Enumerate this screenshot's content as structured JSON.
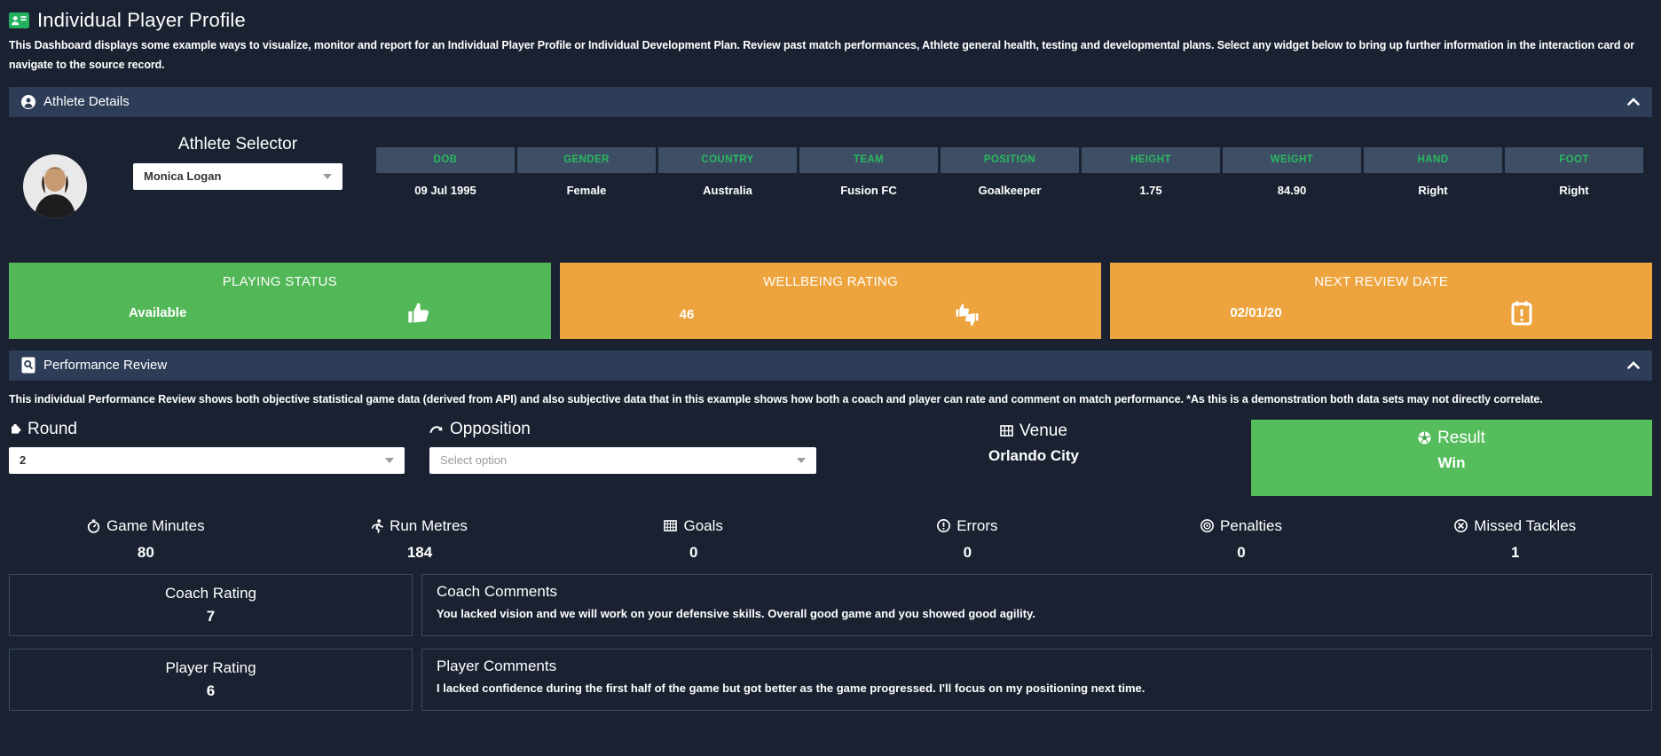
{
  "page": {
    "title": "Individual Player Profile",
    "title_icon": "id-card-icon",
    "description": "This Dashboard displays some example ways to visualize, monitor and report for an Individual Player Profile or Individual Development Plan. Review past match performances, Athlete general health, testing and developmental plans. Select any widget below to bring up further information in the interaction card or navigate to the source record."
  },
  "colors": {
    "background": "#1a2232",
    "section_bar": "#2e3d57",
    "table_header_bg": "#3e4e64",
    "accent_green_text": "#29b960",
    "card_green": "#52b757",
    "card_orange": "#eda43e",
    "result_green": "#55bd5b"
  },
  "athlete_details": {
    "section_title": "Athlete Details",
    "section_icon": "person-icon",
    "collapse_icon": "chevron-up-icon",
    "avatar_icon": "athlete-photo",
    "selector_label": "Athlete Selector",
    "selector_value": "Monica Logan",
    "columns": [
      {
        "header": "DOB",
        "value": "09 Jul 1995"
      },
      {
        "header": "GENDER",
        "value": "Female"
      },
      {
        "header": "COUNTRY",
        "value": "Australia"
      },
      {
        "header": "TEAM",
        "value": "Fusion FC"
      },
      {
        "header": "POSITION",
        "value": "Goalkeeper"
      },
      {
        "header": "HEIGHT",
        "value": "1.75"
      },
      {
        "header": "WEIGHT",
        "value": "84.90"
      },
      {
        "header": "HAND",
        "value": "Right"
      },
      {
        "header": "FOOT",
        "value": "Right"
      }
    ]
  },
  "status_cards": [
    {
      "title": "PLAYING STATUS",
      "value": "Available",
      "icon": "thumbs-up-icon",
      "color": "#52b757"
    },
    {
      "title": "WELLBEING RATING",
      "value": "46",
      "icon": "thumbs-up-down-icon",
      "color": "#eda43e"
    },
    {
      "title": "NEXT REVIEW DATE",
      "value": "02/01/20",
      "icon": "calendar-alert-icon",
      "color": "#eda43e"
    }
  ],
  "performance_review": {
    "section_title": "Performance Review",
    "section_icon": "file-search-icon",
    "collapse_icon": "chevron-up-icon",
    "description": "This individual Performance Review shows both objective statistical game data (derived from API) and also subjective data that in this example shows how both a coach and player can rate and comment on match performance. *As this is a demonstration both data sets may not directly correlate.",
    "round": {
      "label": "Round",
      "value": "2",
      "icon": "puzzle-icon"
    },
    "opposition": {
      "label": "Opposition",
      "placeholder": "Select option",
      "icon": "curved-arrow-icon"
    },
    "venue": {
      "label": "Venue",
      "value": "Orlando City",
      "icon": "stadium-icon"
    },
    "result": {
      "label": "Result",
      "value": "Win",
      "icon": "soccer-ball-icon"
    },
    "stats": [
      {
        "label": "Game Minutes",
        "value": "80",
        "icon": "stopwatch-icon"
      },
      {
        "label": "Run Metres",
        "value": "184",
        "icon": "runner-icon"
      },
      {
        "label": "Goals",
        "value": "0",
        "icon": "goal-net-icon"
      },
      {
        "label": "Errors",
        "value": "0",
        "icon": "error-circle-icon"
      },
      {
        "label": "Penalties",
        "value": "0",
        "icon": "target-icon"
      },
      {
        "label": "Missed Tackles",
        "value": "1",
        "icon": "missed-tackle-icon"
      }
    ],
    "reviews": [
      {
        "rating_label": "Coach Rating",
        "rating_value": "7",
        "comments_label": "Coach Comments",
        "comments_text": "You lacked vision and we will work on your defensive skills. Overall good game and you showed good agility."
      },
      {
        "rating_label": "Player Rating",
        "rating_value": "6",
        "comments_label": "Player Comments",
        "comments_text": "I lacked confidence during the first half of the game but got better as the game progressed. I'll focus on my positioning next time."
      }
    ]
  }
}
